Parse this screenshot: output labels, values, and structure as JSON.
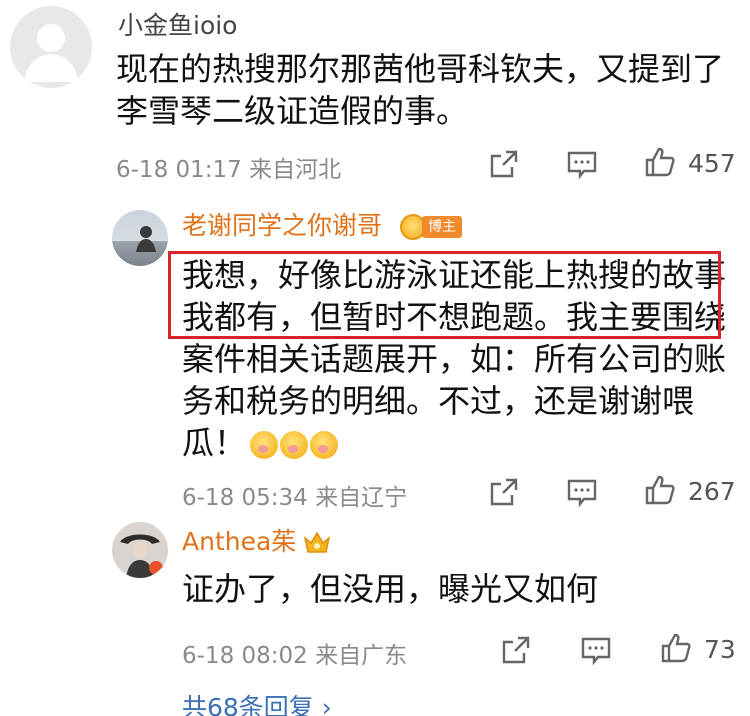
{
  "comments": [
    {
      "username": "小金鱼ioio",
      "content_lines": [
        "现在的热搜那尔那茜他哥科钦夫，又提到了",
        "李雪琴二级证造假的事。"
      ],
      "timestamp": "6-18 01:17",
      "location": "来自河北",
      "likes": "457"
    },
    {
      "username": "老谢同学之你谢哥",
      "badge": "博主",
      "content_lines": [
        "我想，好像比游泳证还能上热搜的故事",
        "我都有，但暂时不想跑题。我主要围绕",
        "案件相关话题展开，如：所有公司的账",
        "务和税务的明细。不过，还是谢谢喂",
        "瓜！"
      ],
      "timestamp": "6-18 05:34",
      "location": "来自辽宁",
      "likes": "267"
    },
    {
      "username": "Anthea茱",
      "content_lines": [
        "证办了，但没用，曝光又如何"
      ],
      "timestamp": "6-18 08:02",
      "location": "来自广东",
      "likes": "73"
    }
  ],
  "replies_link": "共68条回复 ›",
  "icons": {
    "share": "share-icon",
    "comment": "comment-icon",
    "like": "thumbs-up-icon"
  },
  "colors": {
    "username_highlight": "#e0731a",
    "highlight_box": "#d8232a",
    "link": "#3b6fb6",
    "meta": "#8a8a8a"
  }
}
